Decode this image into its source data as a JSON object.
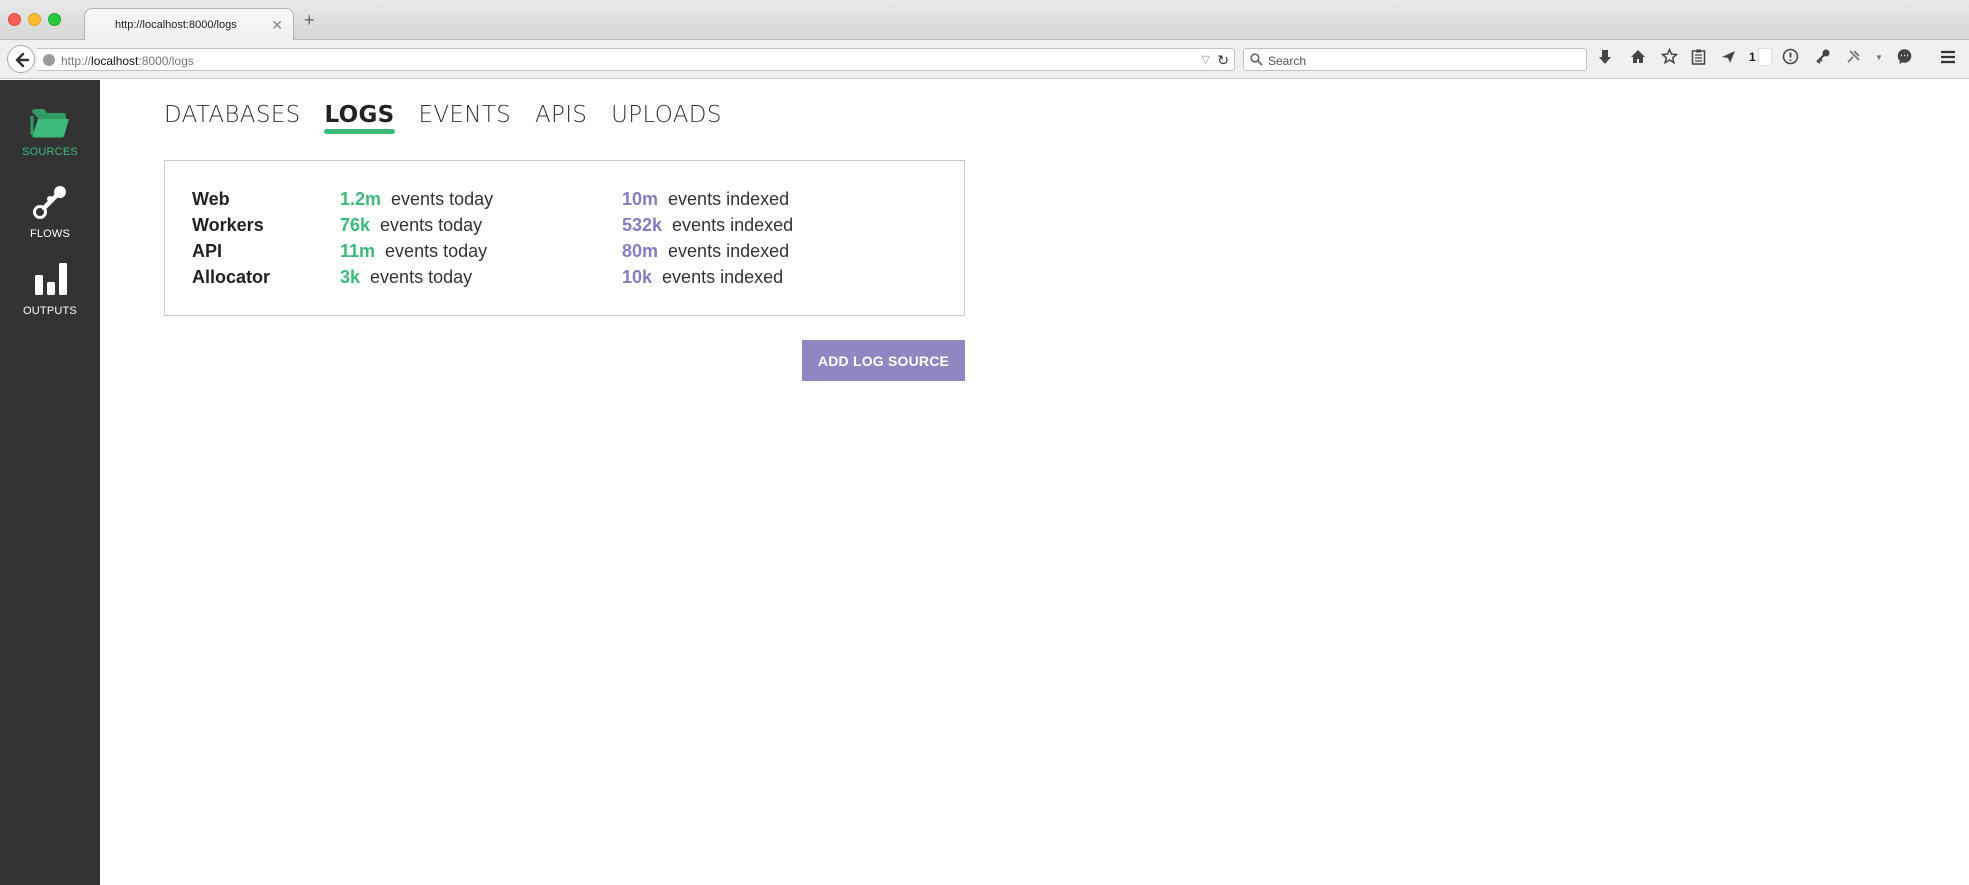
{
  "browser": {
    "tab_title": "http://localhost:8000/logs",
    "tab_close": "✕",
    "new_tab": "+",
    "url_prefix": "http://",
    "url_host": "localhost",
    "url_rest": ":8000/logs",
    "search_placeholder": "Search",
    "toolbar_icons": [
      "download-icon",
      "home-icon",
      "bookmark-star-icon",
      "reading-list-icon",
      "send-icon",
      "extension-icon",
      "info-icon",
      "key-icon",
      "plugin-icon",
      "chat-icon",
      "menu-icon"
    ],
    "toolbar_badge": "1"
  },
  "sidebar": {
    "items": [
      {
        "label": "SOURCES",
        "icon": "folder-icon",
        "active": true
      },
      {
        "label": "FLOWS",
        "icon": "flow-icon",
        "active": false
      },
      {
        "label": "OUTPUTS",
        "icon": "bar-chart-icon",
        "active": false
      }
    ]
  },
  "tabs": [
    {
      "label": "DATABASES",
      "active": false
    },
    {
      "label": "LOGS",
      "active": true
    },
    {
      "label": "EVENTS",
      "active": false
    },
    {
      "label": "APIS",
      "active": false
    },
    {
      "label": "UPLOADS",
      "active": false
    }
  ],
  "log_sources": [
    {
      "name": "Web",
      "today_value": "1.2m",
      "today_label": "events today",
      "indexed_value": "10m",
      "indexed_label": "events indexed"
    },
    {
      "name": "Workers",
      "today_value": "76k",
      "today_label": "events today",
      "indexed_value": "532k",
      "indexed_label": "events indexed"
    },
    {
      "name": "API",
      "today_value": "11m",
      "today_label": "events today",
      "indexed_value": "80m",
      "indexed_label": "events indexed"
    },
    {
      "name": "Allocator",
      "today_value": "3k",
      "today_label": "events today",
      "indexed_value": "10k",
      "indexed_label": "events indexed"
    }
  ],
  "add_button_label": "ADD LOG SOURCE",
  "colors": {
    "accent_green": "#3dba7a",
    "accent_purple": "#8b7cc0",
    "sidebar_bg": "#333333",
    "button_bg": "#9087c2"
  }
}
